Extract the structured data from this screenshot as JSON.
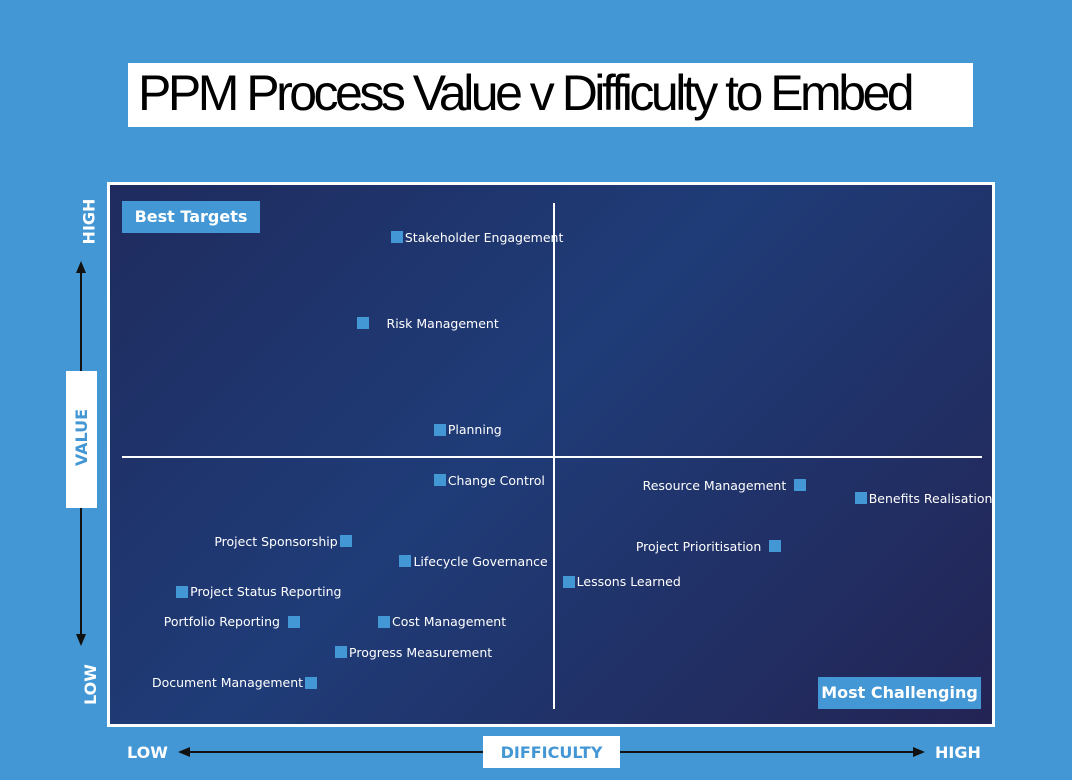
{
  "chart_data": {
    "type": "scatter",
    "title": "PPM Process Value v  Difficulty to Embed",
    "xlabel": "DIFFICULTY",
    "ylabel": "VALUE",
    "x_low_label": "LOW",
    "x_high_label": "HIGH",
    "y_low_label": "LOW",
    "y_high_label": "HIGH",
    "xlim": [
      0,
      10
    ],
    "ylim": [
      0,
      10
    ],
    "quadrant_dividers": {
      "x": 5,
      "y": 5
    },
    "quadrant_labels": {
      "top_left": "Best Targets",
      "bottom_right": "Most Challenging"
    },
    "grid": false,
    "marker_color": "#4497d5",
    "points": [
      {
        "name": "Stakeholder Engagement",
        "difficulty": 3.2,
        "value": 9.3,
        "label_side": "right"
      },
      {
        "name": "Risk Management",
        "difficulty": 2.8,
        "value": 7.6,
        "label_side": "right"
      },
      {
        "name": "Planning",
        "difficulty": 3.7,
        "value": 5.5,
        "label_side": "right"
      },
      {
        "name": "Change Control",
        "difficulty": 3.7,
        "value": 4.5,
        "label_side": "right"
      },
      {
        "name": "Project Sponsorship",
        "difficulty": 2.6,
        "value": 3.3,
        "label_side": "left"
      },
      {
        "name": "Lifecycle Governance",
        "difficulty": 3.3,
        "value": 2.9,
        "label_side": "right"
      },
      {
        "name": "Project Status Reporting",
        "difficulty": 0.7,
        "value": 2.3,
        "label_side": "right"
      },
      {
        "name": "Portfolio Reporting",
        "difficulty": 2.0,
        "value": 1.7,
        "label_side": "left"
      },
      {
        "name": "Cost Management",
        "difficulty": 3.05,
        "value": 1.7,
        "label_side": "right"
      },
      {
        "name": "Progress Measurement",
        "difficulty": 2.55,
        "value": 1.1,
        "label_side": "right"
      },
      {
        "name": "Document Management",
        "difficulty": 2.2,
        "value": 0.5,
        "label_side": "left"
      },
      {
        "name": "Resource Management",
        "difficulty": 7.9,
        "value": 4.4,
        "label_side": "left"
      },
      {
        "name": "Benefits Realisation",
        "difficulty": 8.6,
        "value": 4.15,
        "label_side": "right"
      },
      {
        "name": "Project Prioritisation",
        "difficulty": 7.6,
        "value": 3.2,
        "label_side": "left"
      },
      {
        "name": "Lessons Learned",
        "difficulty": 5.2,
        "value": 2.5,
        "label_side": "right"
      }
    ]
  }
}
